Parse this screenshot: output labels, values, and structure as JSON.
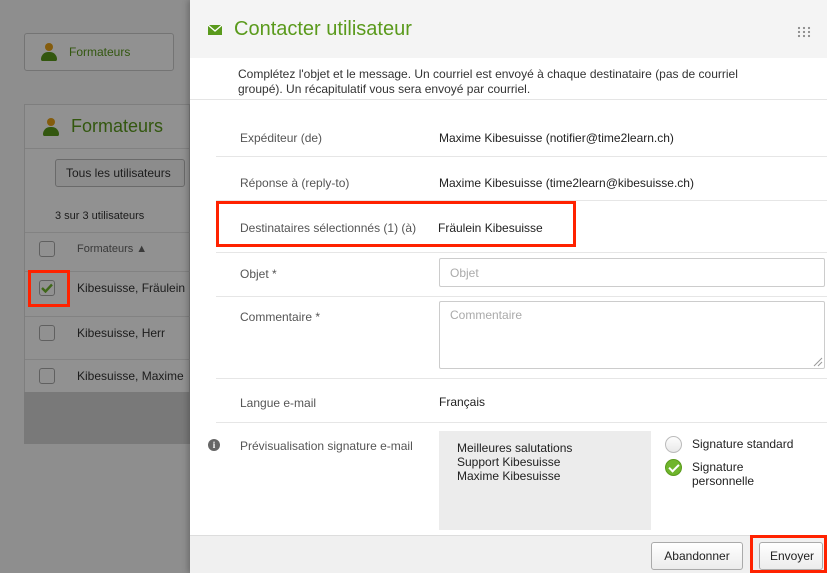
{
  "background": {
    "breadcrumb_label": "Formateurs",
    "panel_title": "Formateurs",
    "filter_label": "Tous les utilisateurs",
    "count_text": "3 sur 3 utilisateurs",
    "column_header": "Formateurs ▲",
    "rows": [
      {
        "name": "Kibesuisse, Fräulein",
        "checked": true
      },
      {
        "name": "Kibesuisse, Herr",
        "checked": false
      },
      {
        "name": "Kibesuisse, Maxime",
        "checked": false
      }
    ]
  },
  "modal": {
    "title": "Contacter utilisateur",
    "intro": "Complétez l'objet et le message. Un courriel est envoyé à chaque destinataire (pas de courriel groupé). Un récapitulatif vous sera envoyé par courriel.",
    "sender_label": "Expéditeur (de)",
    "sender_value": "Maxime Kibesuisse (notifier@time2learn.ch)",
    "reply_label": "Réponse à (reply-to)",
    "reply_value": "Maxime Kibesuisse (time2learn@kibesuisse.ch)",
    "recipients_label": "Destinataires sélectionnés (1) (à)",
    "recipients_value": "Fräulein Kibesuisse",
    "subject_label": "Objet *",
    "subject_placeholder": "Objet",
    "comment_label": "Commentaire *",
    "comment_placeholder": "Commentaire",
    "language_label": "Langue e-mail",
    "language_value": "Français",
    "signature_label": "Prévisualisation signature e-mail",
    "signature_lines": [
      "Meilleures salutations",
      "Support Kibesuisse",
      "Maxime Kibesuisse"
    ],
    "signature_options": [
      {
        "label": "Signature standard",
        "selected": false
      },
      {
        "label": "Signature personnelle",
        "selected": true
      }
    ],
    "cancel_label": "Abandonner",
    "send_label": "Envoyer"
  },
  "colors": {
    "brand_green": "#5a9a1c",
    "highlight_red": "#ff2200"
  },
  "icons": [
    "user-icon",
    "mail-icon",
    "grid-icon",
    "info-icon",
    "check-icon"
  ]
}
